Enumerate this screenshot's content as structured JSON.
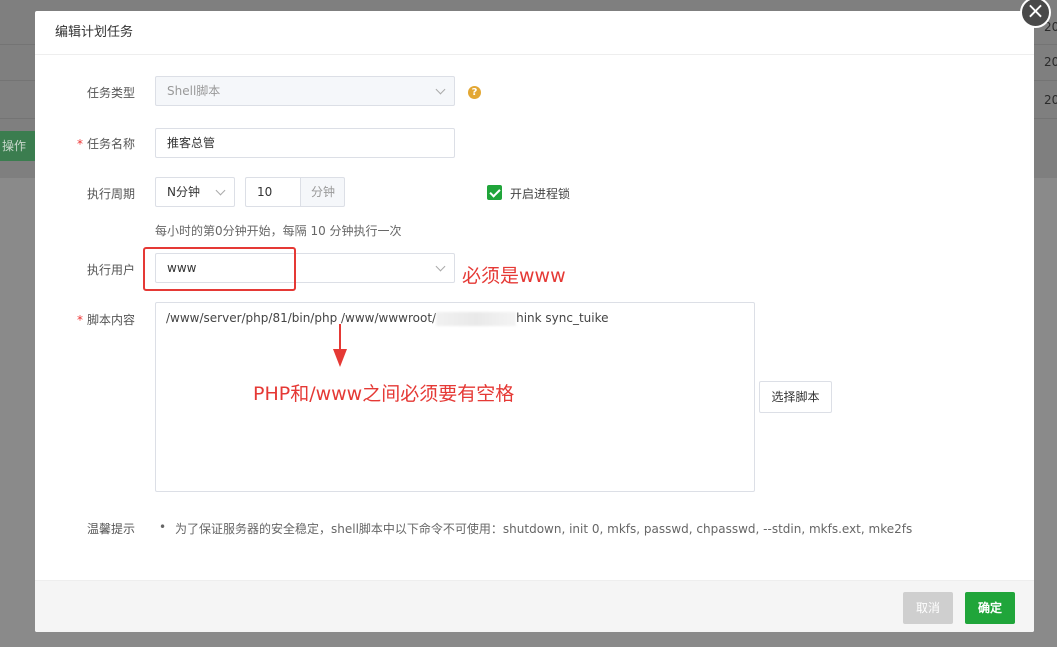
{
  "background": {
    "operation_button": "操作",
    "right_values": [
      "20",
      "20",
      "20"
    ]
  },
  "modal": {
    "title": "编辑计划任务",
    "close_glyph": "×"
  },
  "form": {
    "task_type": {
      "label": "任务类型",
      "value": "Shell脚本",
      "help_glyph": "?"
    },
    "task_name": {
      "label": "任务名称",
      "value": "推客总管"
    },
    "period": {
      "label": "执行周期",
      "unit_select": "N分钟",
      "value": "10",
      "suffix": "分钟",
      "process_lock_label": "开启进程锁",
      "process_lock_checked": true,
      "description": "每小时的第0分钟开始，每隔 10 分钟执行一次"
    },
    "user": {
      "label": "执行用户",
      "value": "www"
    },
    "script": {
      "label": "脚本内容",
      "content_before": "/www/server/php/81/bin/php /www/wwwroot/",
      "content_after": "hink sync_tuike",
      "choose_button": "选择脚本"
    },
    "tips": {
      "label": "温馨提示",
      "bullet": "•",
      "text": "为了保证服务器的安全稳定，shell脚本中以下命令不可使用：shutdown, init 0, mkfs, passwd, chpasswd, --stdin, mkfs.ext, mke2fs"
    }
  },
  "annotations": {
    "user_note": "必须是www",
    "space_note": "PHP和/www之间必须要有空格",
    "color": "#e53935"
  },
  "footer": {
    "cancel": "取消",
    "confirm": "确定"
  },
  "colors": {
    "accent": "#20a53a",
    "help": "#e3a733",
    "annotation": "#e53935"
  }
}
